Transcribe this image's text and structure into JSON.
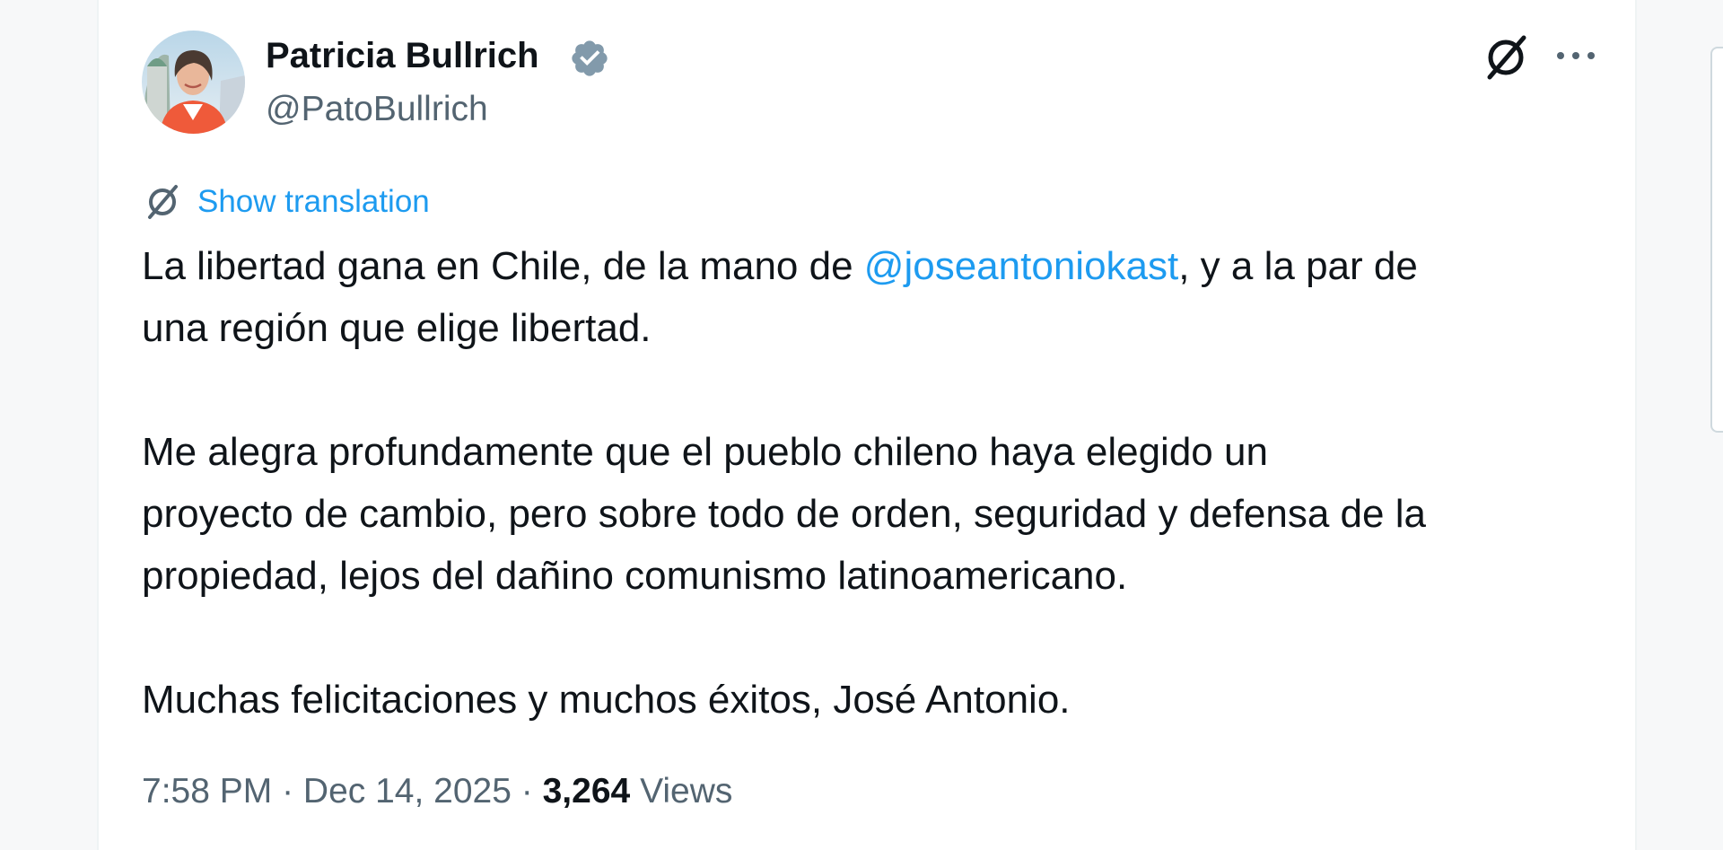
{
  "tweet": {
    "author": {
      "name": "Patricia Bullrich",
      "handle": "@PatoBullrich",
      "verified_color": "#829aab",
      "avatar_icon": "profile-photo"
    },
    "actions": {
      "grok_icon": "grok-icon",
      "more_icon": "more-options-icon"
    },
    "translate": {
      "icon": "grok-translate-icon",
      "label": "Show translation"
    },
    "body": {
      "p1_before": "La libertad gana en Chile, de la mano de ",
      "p1_mention": "@joseantoniokast",
      "p1_after": ", y a la par de",
      "p1_line2": "una región que elige libertad.",
      "p2_line1": "Me alegra profundamente que el pueblo chileno haya elegido un",
      "p2_line2": "proyecto de cambio, pero sobre todo de orden, seguridad y defensa de la",
      "p2_line3": "propiedad, lejos del dañino comunismo latinoamericano.",
      "p3_line1": "Muchas felicitaciones y muchos éxitos, José Antonio."
    },
    "meta": {
      "time": "7:58 PM",
      "separator": " · ",
      "date": "Dec 14, 2025",
      "views_count": "3,264",
      "views_label": "Views"
    },
    "colors": {
      "text": "#0f1419",
      "secondary": "#536471",
      "link": "#1d9bf0",
      "accent_jacket": "#ef5a3a"
    }
  }
}
